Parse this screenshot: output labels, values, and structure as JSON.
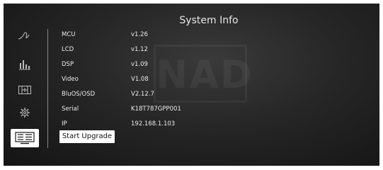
{
  "window": {
    "title": "System Info",
    "watermark_text": "NAD"
  },
  "sidebar": {
    "items": [
      {
        "name": "wave-icon",
        "active": false
      },
      {
        "name": "equalizer-icon",
        "active": false
      },
      {
        "name": "speaker-layout-icon",
        "active": false
      },
      {
        "name": "gear-icon",
        "active": false
      },
      {
        "name": "system-info-icon",
        "active": true
      }
    ]
  },
  "info": {
    "rows": [
      {
        "label": "MCU",
        "value": "v1.26"
      },
      {
        "label": "LCD",
        "value": "v1.12"
      },
      {
        "label": "DSP",
        "value": "v1.09"
      },
      {
        "label": "Video",
        "value": "V1.08"
      },
      {
        "label": "BluOS/OSD",
        "value": "V2.12.7"
      },
      {
        "label": "Serial",
        "value": "K18T787GPP001"
      },
      {
        "label": "IP",
        "value": "192.168.1.103"
      }
    ]
  },
  "actions": {
    "upgrade_label": "Start Upgrade"
  },
  "colors": {
    "background": "#262626",
    "text": "#ececec",
    "highlight": "#ffffff"
  }
}
